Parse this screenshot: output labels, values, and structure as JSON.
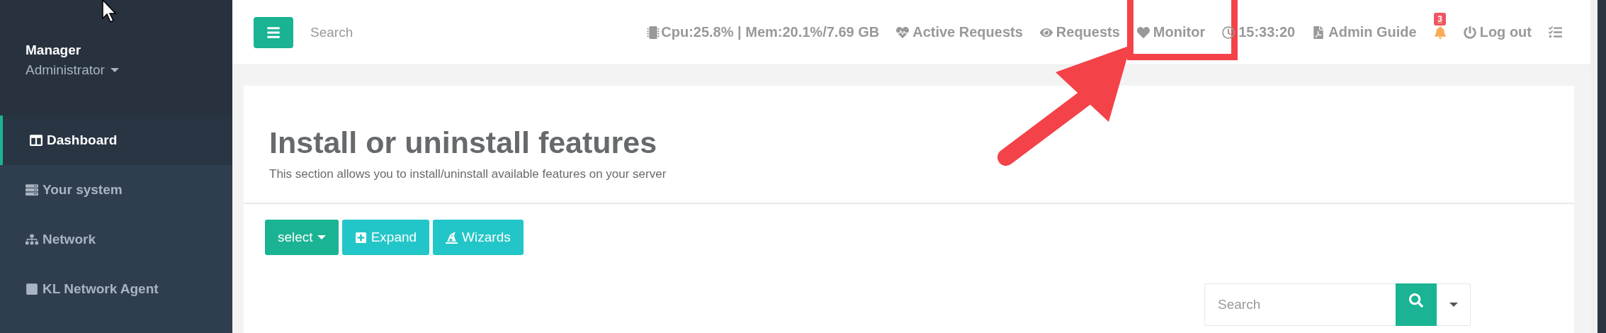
{
  "sidebar": {
    "user": {
      "name": "Manager",
      "role": "Administrator"
    },
    "items": [
      {
        "label": "Dashboard",
        "selected": true
      },
      {
        "label": "Your system",
        "selected": false
      },
      {
        "label": "Network",
        "selected": false
      },
      {
        "label": "KL Network Agent",
        "selected": false
      }
    ]
  },
  "topbar": {
    "search": {
      "placeholder": "Search"
    },
    "items": [
      {
        "kind": "stat",
        "label": "Cpu:25.8% | Mem:20.1%/7.69 GB"
      },
      {
        "kind": "link",
        "label": "Active Requests",
        "highlighted": false
      },
      {
        "kind": "link",
        "label": "Requests",
        "highlighted": false
      },
      {
        "kind": "link",
        "label": "Monitor",
        "highlighted": true
      },
      {
        "kind": "link",
        "label": "15:33:20",
        "highlighted": false
      },
      {
        "kind": "link",
        "label": "Admin Guide",
        "highlighted": false
      },
      {
        "kind": "bell",
        "badge": "3"
      },
      {
        "kind": "link",
        "label": "Log out",
        "highlighted": false
      },
      {
        "kind": "tasks"
      }
    ]
  },
  "page": {
    "title": "Install or uninstall features",
    "subtitle": "This section allows you to install/uninstall available features on your server",
    "toolbar": [
      {
        "kind": "dropdown",
        "label": "select"
      },
      {
        "kind": "expand",
        "label": "Expand"
      },
      {
        "kind": "wizard",
        "label": "Wizards"
      }
    ],
    "table_search": {
      "placeholder": "Search"
    }
  }
}
